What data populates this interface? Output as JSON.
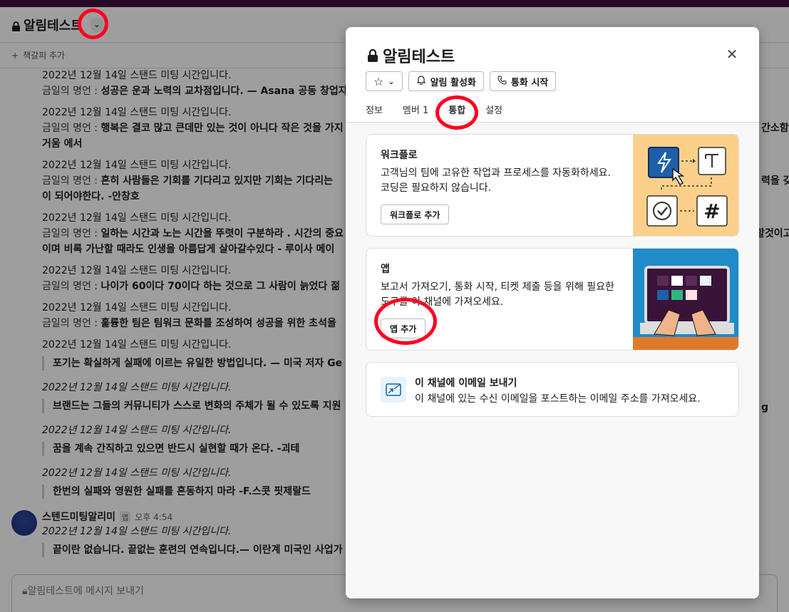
{
  "background": {
    "channel_title": "알림테스트",
    "bookmark_add": "책갈피 추가",
    "messages": [
      {
        "line1": "2022년 12월 14일 스탠드 미팅 시간입니다.",
        "label": "금일의 명언 : ",
        "quote": "성공은 운과 노력의 교차점입니다. — Asana 공동 창업자"
      },
      {
        "line1": "2022년 12월 14일 스탠드 미팅 시간입니다.",
        "label": "금일의 명언 : ",
        "quote": "행복은 결코 많고 큰데만 있는 것이 아니다 작은 것을 가지",
        "quote_tail": "간소함",
        "cont": "거움 에서"
      },
      {
        "line1": "2022년 12월 14일 스탠드 미팅 시간입니다.",
        "label": "금일의 명언 : ",
        "quote": "흔히 사람들은 기회를 기다리고 있지만 기회는 기다리는",
        "quote_tail": "력을 갖",
        "cont": "이 되어야한다. -안창호"
      },
      {
        "line1": "2022년 12월 14일 스탠드 미팅 시간입니다.",
        "label": "금일의 명언 : ",
        "quote": "일하는 시간과 노는 시간을 뚜렷이 구분하라 . 시간의 중요",
        "quote_tail": "할것이고",
        "cont": "이며 비록 가난할 때라도 인생을 아름답게 살아갈수있다 - 루이사 메이"
      },
      {
        "line1": "2022년 12월 14일 스탠드 미팅 시간입니다.",
        "label": "금일의 명언 : ",
        "quote": "나이가 60이다 70이다 하는 것으로 그 사람이 늙었다 젊"
      },
      {
        "line1": "2022년 12월 14일 스탠드 미팅 시간입니다.",
        "label": "금일의 명언 : ",
        "quote": "훌륭한 팀은 팀워크 문화를 조성하여 성공을 위한 초석을"
      },
      {
        "line1": "2022년 12월 14일 스탠드 미팅 시간입니다.",
        "quote": "포기는 확실하게 실패에 이르는 유일한 방법입니다. — 미국 저자 Ge"
      },
      {
        "line1": "2022년 12월 14일 스탠드 미팅 시간입니다.",
        "quote": "브랜드는 그들의 커뮤니티가 스스로 변화의 주체가 될 수 있도록 지원",
        "quote_tail": "g"
      },
      {
        "line1": "2022년 12월 14일 스탠드 미팅 시간입니다.",
        "quote": "꿈을 계속 간직하고 있으면 반드시 실현할 때가 온다. -괴테"
      },
      {
        "line1": "2022년 12월 14일 스탠드 미팅 시간입니다.",
        "quote": "한번의 실패와 영원한 실패를 혼동하지 마라 -F.스콧 핏제랄드"
      },
      {
        "line1": "2022년 12월 14일 스탠드 미팅 시간입니다.",
        "quote": "끝이란 없습니다. 끝없는 훈련의 연속입니다.— 이란계 미국인 사업가"
      }
    ],
    "sender": "스텐드미팅알리미",
    "app_badge": "앱",
    "time": "오후 4:54",
    "composer_placeholder": "알림테스트에 메시지 보내기"
  },
  "modal": {
    "title": "알림테스트",
    "buttons": {
      "star": "☆",
      "notify": "알림 활성화",
      "call": "통화 시작"
    },
    "tabs": [
      {
        "label": "정보"
      },
      {
        "label": "멤버 1"
      },
      {
        "label": "통합"
      },
      {
        "label": "설정"
      }
    ],
    "workflow_card": {
      "title": "워크플로",
      "desc": "고객님의 팀에 고유한 작업과 프로세스를 자동화하세요. 코딩은 필요하지 않습니다.",
      "button": "워크플로 추가"
    },
    "apps_card": {
      "title": "앱",
      "desc": "보고서 가져오기, 통화 시작, 티켓 제출 등을 위해 필요한 도구를 이 채널에 가져오세요.",
      "button": "앱 추가"
    },
    "email_card": {
      "title": "이 채널에 이메일 보내기",
      "desc": "이 채널에 있는 수신 이메일을 포스트하는 이메일 주소를 가져오세요."
    }
  },
  "colors": {
    "annotation_red": "#ff0020",
    "workflow_bg": "#fcd08a",
    "apps_bg": "#1f8bc8"
  }
}
